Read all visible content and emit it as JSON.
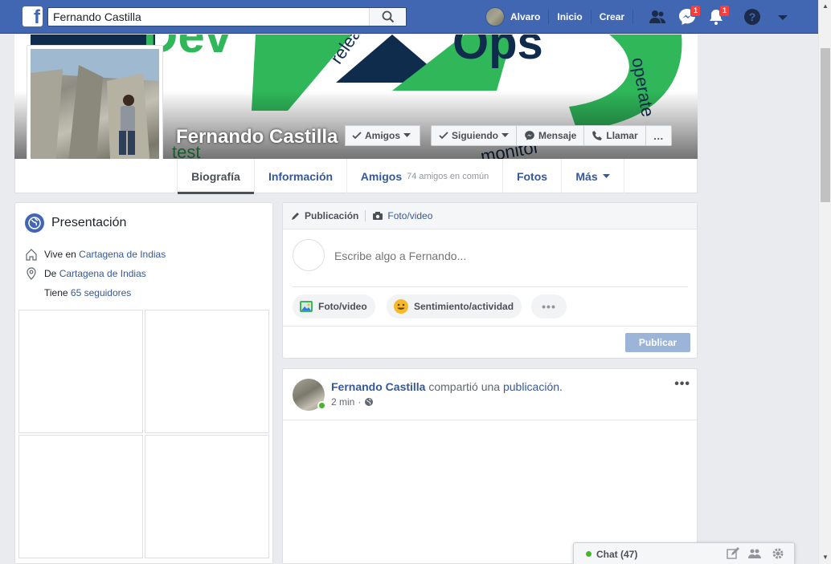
{
  "topbar": {
    "search_value": "Fernando Castilla",
    "user_name": "Alvaro",
    "home_label": "Inicio",
    "create_label": "Crear",
    "messages_badge": "1",
    "notifications_badge": "1"
  },
  "cover": {
    "cover_words": [
      "Dev",
      "Ops",
      "release",
      "operate",
      "test",
      "monitor"
    ],
    "profile_name": "Fernando Castilla",
    "friends_button": "Amigos",
    "following_button": "Siguiendo",
    "message_button": "Mensaje",
    "call_button": "Llamar",
    "more_button": "…"
  },
  "tabs": [
    {
      "label": "Biografía",
      "sub": ""
    },
    {
      "label": "Información",
      "sub": ""
    },
    {
      "label": "Amigos",
      "sub": "74 amigos en común"
    },
    {
      "label": "Fotos",
      "sub": ""
    },
    {
      "label": "Más",
      "sub": ""
    }
  ],
  "intro": {
    "title": "Presentación",
    "lives_prefix": "Vive en",
    "lives_link": "Cartagena de Indias",
    "from_prefix": "De",
    "from_link": "Cartagena de Indias",
    "followers_prefix": "Tiene",
    "followers_link": "65 seguidores"
  },
  "composer": {
    "post_tab": "Publicación",
    "photo_tab": "Foto/video",
    "placeholder": "Escribe algo a Fernando...",
    "photo_pill": "Foto/video",
    "feeling_pill": "Sentimiento/actividad",
    "publish_button": "Publicar"
  },
  "post": {
    "author": "Fernando Castilla",
    "action_text": "compartió una",
    "action_link": "publicación.",
    "time": "2 min",
    "privacy_separator": "·"
  },
  "chat": {
    "label": "Chat (47)"
  },
  "colors": {
    "brand": "#4267b2",
    "link": "#365899",
    "cover_green": "#2fb75a",
    "cover_navy": "#0f2c4c",
    "badge": "#fa3e3e",
    "online": "#42b72a"
  }
}
